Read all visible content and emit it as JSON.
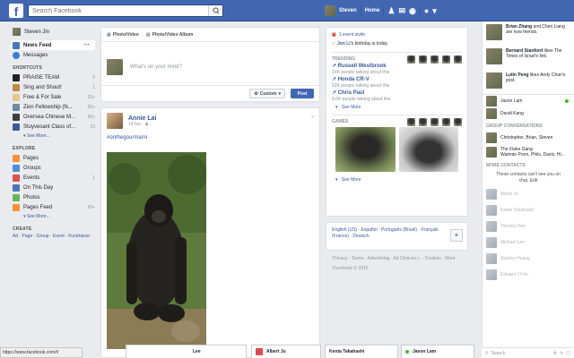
{
  "topbar": {
    "logo": "f",
    "search_placeholder": "Search Facebook",
    "user": "Steven",
    "home": "Home"
  },
  "left": {
    "profile": "Steven Jin",
    "news_feed": "News Feed",
    "messages": "Messages",
    "shortcuts_head": "SHORTCUTS",
    "shortcuts": [
      {
        "label": "PRAISE TEAM",
        "count": "5",
        "color": "#222"
      },
      {
        "label": "Sing and Shout!",
        "count": "1",
        "color": "#c08a40"
      },
      {
        "label": "Free & For Sale",
        "count": "20+",
        "color": "#e0c98a"
      },
      {
        "label": "Zion Fellowship (N...",
        "count": "20+",
        "color": "#6d8aa8"
      },
      {
        "label": "Oversea Chinese M...",
        "count": "20+",
        "color": "#3c3c3c"
      },
      {
        "label": "Stuyvesant Class of...",
        "count": "13",
        "color": "#3b5998"
      }
    ],
    "shortcuts_more": "See More...",
    "explore_head": "EXPLORE",
    "explore": [
      {
        "label": "Pages",
        "count": "",
        "color": "#f7923b"
      },
      {
        "label": "Groups",
        "count": "",
        "color": "#4a90d9"
      },
      {
        "label": "Events",
        "count": "1",
        "color": "#e04c4c"
      },
      {
        "label": "On This Day",
        "count": "",
        "color": "#4a76b8"
      },
      {
        "label": "Photos",
        "count": "",
        "color": "#6cb35f"
      },
      {
        "label": "Pages Feed",
        "count": "20+",
        "color": "#f7923b"
      }
    ],
    "explore_more": "See More...",
    "create_head": "CREATE",
    "create_links": "Ad · Page · Group · Event · Fundraiser"
  },
  "composer": {
    "tab_photo": "Photo/Video",
    "tab_album": "Photo/Video Album",
    "placeholder": "What's on your mind?",
    "audience": "Custom",
    "post": "Post"
  },
  "post": {
    "author": "Annie Lai",
    "time": "14 hrs · ",
    "hashtag": "#onthegourmami"
  },
  "events": {
    "invite": "1 event invite",
    "birthday_name": "Jon Li",
    "birthday_text": "'s birthday is today",
    "trending_head": "TRENDING",
    "trending": [
      {
        "name": "Russell Westbrook",
        "sub": "16K people talking about this"
      },
      {
        "name": "Honda CR-V",
        "sub": "52K people talking about this"
      },
      {
        "name": "Chris Paul",
        "sub": "8.6K people talking about this"
      }
    ],
    "see_more": "See More",
    "games_head": "GAMES",
    "games_more": "See More"
  },
  "lang": {
    "links": "English (US) · Español · Português (Brasil) · Français (France) · Deutsch",
    "plus": "+"
  },
  "footer": {
    "links": "Privacy · Terms · Advertising · Ad Choices ▷ · Cookies · More ·",
    "copyright": "Facebook © 2016"
  },
  "chat": {
    "stories": [
      {
        "name": "Brian Zhang",
        "text": " and Chen Liang are now friends."
      },
      {
        "name": "Bernard Stanford",
        "text": " likes The Times of Israel's link."
      },
      {
        "name": "Lulin Peng",
        "text": " likes Andy Chan's post."
      }
    ],
    "friends": [
      {
        "name": "Jason Lam",
        "online": true
      },
      {
        "name": "David Kang",
        "online": false
      }
    ],
    "group_head": "GROUP CONVERSATIONS",
    "groups": [
      "Christopher, Brian, Steven",
      "The Flake Gang\nWaiman Poon, Phils, Davis, Hi..."
    ],
    "more_head": "MORE CONTACTS",
    "more_msg": "These contacts can't see you on chat. Edit",
    "contacts": [
      "Albert Ju",
      "Kenta Takahashi",
      "Timothy Han",
      "Michael Lee",
      "Stanley Huang",
      "Edward J Kim"
    ],
    "search": "Search"
  },
  "dock": [
    {
      "label": "Lee"
    },
    {
      "label": "Albert Ju"
    },
    {
      "label": "Kenta Takahashi"
    },
    {
      "label": "Jason Lam"
    }
  ],
  "statusbar": "https://www.facebook.com/#"
}
